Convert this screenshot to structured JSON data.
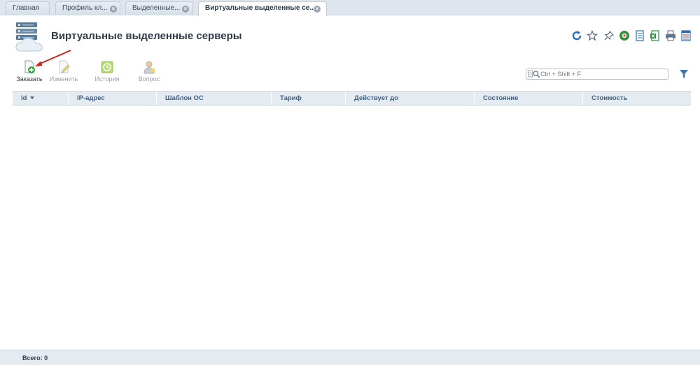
{
  "tabs": [
    {
      "label": "Главная",
      "closable": false,
      "active": false
    },
    {
      "label": "Профиль кл...",
      "closable": true,
      "active": false
    },
    {
      "label": "Выделенные...",
      "closable": true,
      "active": false
    },
    {
      "label": "Виртуальные выделенные се...",
      "closable": true,
      "active": true
    }
  ],
  "header": {
    "title": "Виртуальные выделенные серверы",
    "icons": [
      "refresh-icon",
      "favorite-star-icon",
      "pin-icon",
      "colored-circle-icon",
      "document-icon",
      "excel-export-icon",
      "print-icon",
      "settings-list-icon"
    ]
  },
  "toolbar": {
    "order_label": "Заказать",
    "edit_label": "Изменить",
    "history_label": "История",
    "question_label": "Вопрос"
  },
  "search": {
    "placeholder": "Ctrl + Shift + F",
    "value": ""
  },
  "table": {
    "columns": [
      "Id",
      "IP-адрес",
      "Шаблон ОС",
      "Тариф",
      "Действует до",
      "Состояние",
      "Стоимость"
    ],
    "sorted_column": "Id",
    "rows": []
  },
  "footer": {
    "total": "Всего: 0"
  },
  "colors": {
    "accent": "#41607f",
    "header_bg": "#e4ebf1",
    "arrow": "#d0211c"
  }
}
